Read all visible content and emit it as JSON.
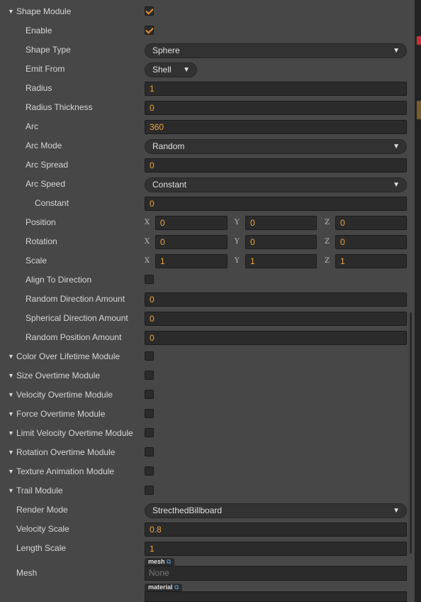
{
  "shape_module": {
    "title": "Shape Module",
    "checked": true,
    "enable": {
      "label": "Enable",
      "checked": true
    },
    "shape_type": {
      "label": "Shape Type",
      "value": "Sphere"
    },
    "emit_from": {
      "label": "Emit From",
      "value": "Shell"
    },
    "radius": {
      "label": "Radius",
      "value": "1"
    },
    "radius_thickness": {
      "label": "Radius Thickness",
      "value": "0"
    },
    "arc": {
      "label": "Arc",
      "value": "360"
    },
    "arc_mode": {
      "label": "Arc Mode",
      "value": "Random"
    },
    "arc_spread": {
      "label": "Arc Spread",
      "value": "0"
    },
    "arc_speed": {
      "label": "Arc Speed",
      "value": "Constant"
    },
    "constant": {
      "label": "Constant",
      "value": "0"
    },
    "position": {
      "label": "Position",
      "x": "0",
      "y": "0",
      "z": "0"
    },
    "rotation": {
      "label": "Rotation",
      "x": "0",
      "y": "0",
      "z": "0"
    },
    "scale": {
      "label": "Scale",
      "x": "1",
      "y": "1",
      "z": "1"
    },
    "align_to_direction": {
      "label": "Align To Direction",
      "checked": false
    },
    "random_direction_amount": {
      "label": "Random Direction Amount",
      "value": "0"
    },
    "spherical_direction_amount": {
      "label": "Spherical Direction Amount",
      "value": "0"
    },
    "random_position_amount": {
      "label": "Random Position Amount",
      "value": "0"
    }
  },
  "axis_labels": {
    "x": "X",
    "y": "Y",
    "z": "Z"
  },
  "modules": [
    {
      "label": "Color Over Lifetime Module",
      "checked": false
    },
    {
      "label": "Size Overtime Module",
      "checked": false
    },
    {
      "label": "Velocity Overtime Module",
      "checked": false
    },
    {
      "label": "Force Overtime Module",
      "checked": false
    },
    {
      "label": "Limit Velocity Overtime Module",
      "checked": false
    },
    {
      "label": "Rotation Overtime Module",
      "checked": false
    },
    {
      "label": "Texture Animation Module",
      "checked": false
    }
  ],
  "trail_module": {
    "title": "Trail Module",
    "checked": false,
    "render_mode": {
      "label": "Render Mode",
      "value": "StrecthedBillboard"
    },
    "velocity_scale": {
      "label": "Velocity Scale",
      "value": "0.8"
    },
    "length_scale": {
      "label": "Length Scale",
      "value": "1"
    },
    "mesh": {
      "label": "Mesh",
      "tag": "mesh",
      "value": "None"
    },
    "material": {
      "tag": "material"
    }
  },
  "icons": {
    "expand": "triangle-down-icon",
    "check": "checkmark-icon",
    "dropdown": "triangle-down-icon",
    "link": "external-link-icon"
  },
  "colors": {
    "panel_bg": "#474747",
    "field_bg": "#2b2b2b",
    "value_text": "#f0a53a",
    "label_text": "#d6d6d6",
    "check_mark": "#e8902e"
  }
}
